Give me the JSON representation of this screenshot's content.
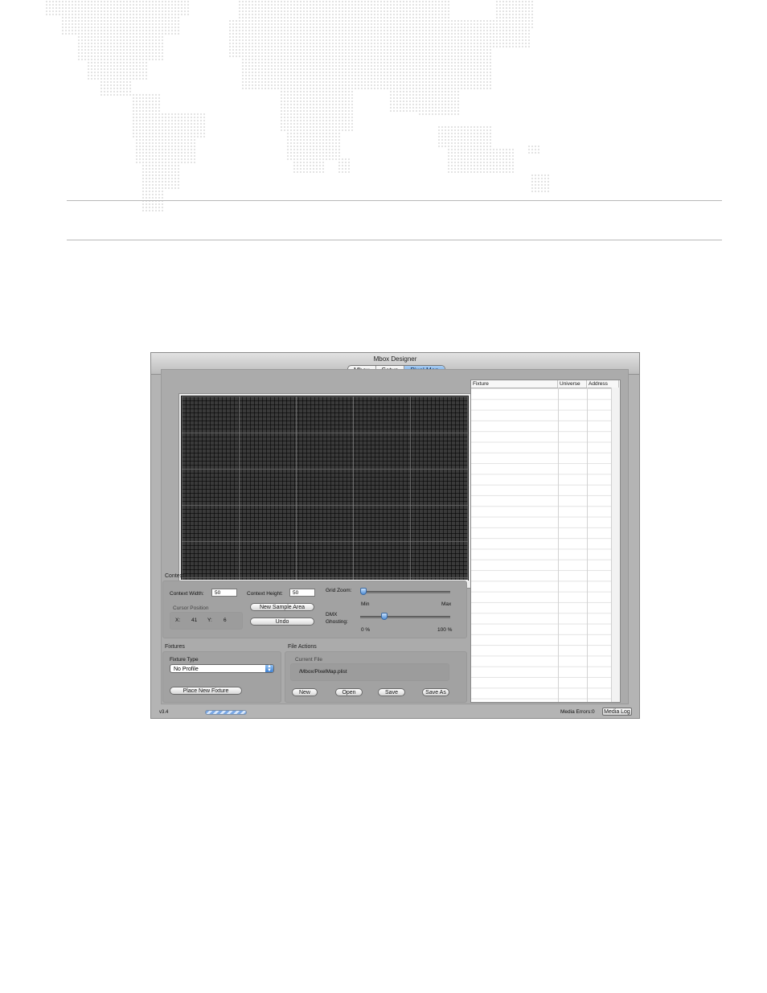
{
  "window": {
    "title": "Mbox Designer",
    "tabs": [
      {
        "label": "Mbox",
        "selected": false
      },
      {
        "label": "Setup",
        "selected": false
      },
      {
        "label": "Pixel Map",
        "selected": true
      }
    ]
  },
  "context": {
    "group_title": "Context",
    "width_label": "Context Width:",
    "width_value": "50",
    "height_label": "Context Height:",
    "height_value": "50",
    "cursor_title": "Cursor Position",
    "x_label": "X:",
    "x_value": "41",
    "y_label": "Y:",
    "y_value": "6",
    "new_sample_area_label": "New Sample Area",
    "undo_label": "Undo",
    "grid_zoom_label": "Grid Zoom:",
    "grid_zoom_min": "Min",
    "grid_zoom_max": "Max",
    "grid_zoom_level": 0.0,
    "dmx_ghosting_label_1": "DMX",
    "dmx_ghosting_label_2": "Ghosting:",
    "dmx_ghosting_min": "0 %",
    "dmx_ghosting_max": "100 %",
    "dmx_ghosting_level": 0.25
  },
  "fixtures": {
    "group_title": "Fixtures",
    "type_label": "Fixture Type",
    "type_selected": "No Profile",
    "place_label": "Place New Fixture"
  },
  "file_actions": {
    "group_title": "File Actions",
    "current_file_label": "Current File",
    "current_file_path": "/Mbox/PixelMap.plist",
    "new_label": "New",
    "open_label": "Open",
    "save_label": "Save",
    "save_as_label": "Save As"
  },
  "table": {
    "columns": [
      "Fixture",
      "Universe",
      "Address"
    ],
    "rows": []
  },
  "status": {
    "version": "v3.4",
    "media_errors": "Media Errors:0",
    "media_log_label": "Media Log"
  },
  "colors": {
    "window_bg": "#b4b4b4",
    "grid_bg": "#3a3a3a",
    "accent_blue": "#5e9ee2"
  }
}
